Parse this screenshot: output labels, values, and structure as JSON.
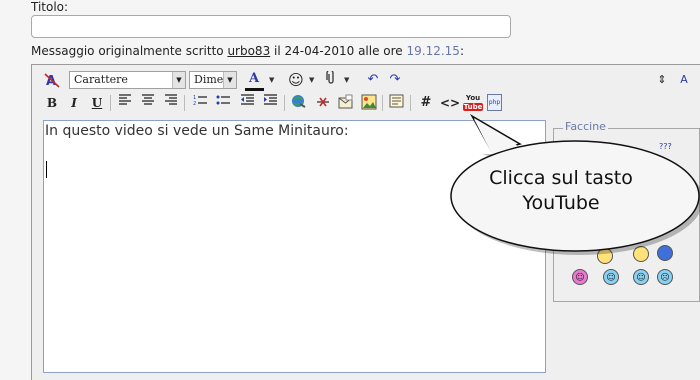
{
  "form": {
    "title_label": "Titolo:",
    "title_value": "",
    "original_prefix": "Messaggio originalmente scritto ",
    "original_user": "urbo83",
    "original_mid": " il 24-04-2010 alle ore ",
    "original_time": "19.12.15",
    "original_suffix": ":"
  },
  "toolbar": {
    "font_select": "Carattere",
    "size_select": "Dime",
    "bold": "B",
    "italic": "I",
    "underline": "U",
    "font_color": "A",
    "code": "#",
    "html": "<>",
    "youtube_top": "You",
    "youtube_bottom": "Tube",
    "php": "php",
    "side_resize": "A"
  },
  "editor": {
    "text": "In questo video si vede un Same Minitauro:"
  },
  "smilies": {
    "legend": "Faccine",
    "more": "???"
  },
  "callout": {
    "line1": "Clicca sul tasto",
    "line2": "YouTube"
  },
  "colors": {
    "accent": "#6a79a8",
    "youtube_red": "#d6201f",
    "editor_border": "#8ca0c8"
  }
}
